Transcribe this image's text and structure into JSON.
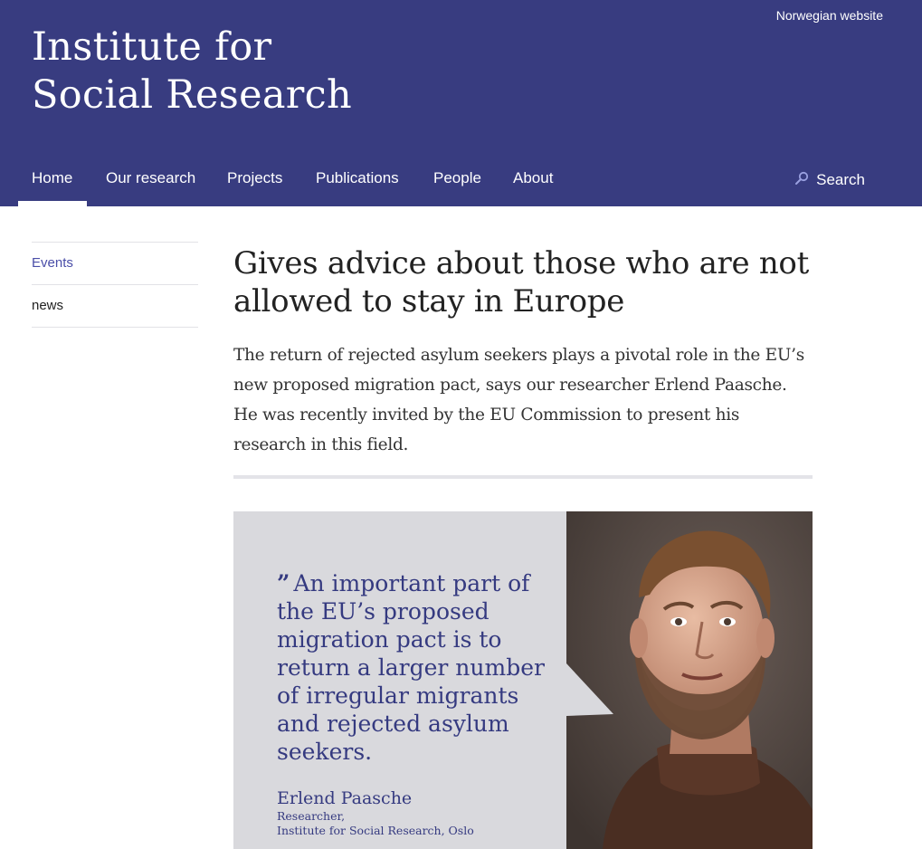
{
  "header": {
    "lang_link": "Norwegian website",
    "title_line1": "Institute for",
    "title_line2": "Social Research",
    "bg_color": "#383c80"
  },
  "nav": {
    "items": [
      "Home",
      "Our research",
      "Projects",
      "Publications",
      "People",
      "About"
    ],
    "active": "Home",
    "search_label": "Search"
  },
  "sidebar": {
    "items": [
      {
        "label": "Events",
        "active": true
      },
      {
        "label": "news",
        "active": false
      }
    ]
  },
  "article": {
    "headline": "Gives advice about those who are not allowed to stay in Europe",
    "lead": "The return of rejected asylum seekers plays a pivotal role in the EU’s new proposed migration pact, says our researcher Erlend Paasche. He was recently invited by the EU Commission to present his research in this field."
  },
  "figure": {
    "quote_mark": "”",
    "quote": "An important part of the EU’s proposed migration pact is to return a larger number of irregular migrants and rejected asylum seekers.",
    "author_name": "Erlend Paasche",
    "author_role1": "Researcher,",
    "author_role2": "Institute for Social Research, Oslo",
    "accent_color": "#353a80"
  }
}
